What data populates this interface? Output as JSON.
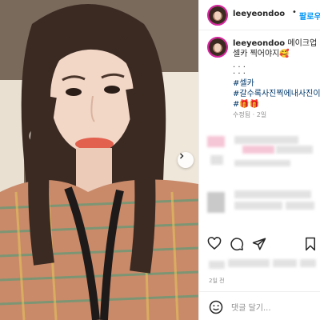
{
  "post": {
    "username": "leeyeondoo",
    "follow_label": "팔로우",
    "separator": "•",
    "caption": {
      "username": "leeyeondoo",
      "line1": "메이크업 가권",
      "line2": "셀카 찍어야지",
      "line2_emoji": "🥰",
      "dots": ". . .",
      "hashtags": [
        "#셀카",
        "#갈수록사진찍에내사진이"
      ],
      "emoji_line": "#🎁🎁"
    },
    "edited": "수정됨 · 2일",
    "date": "2일 전",
    "comment_placeholder": "댓글 달기..."
  },
  "icons": {
    "carousel_next": "chevron-right-icon",
    "like": "heart-icon",
    "comment": "comment-icon",
    "share": "paper-plane-icon",
    "save": "bookmark-icon",
    "emoji": "smiley-icon"
  },
  "colors": {
    "follow": "#0095f6",
    "hashtag": "#00376b",
    "muted": "#8e8e8e",
    "story_ring": "#d6249f"
  }
}
